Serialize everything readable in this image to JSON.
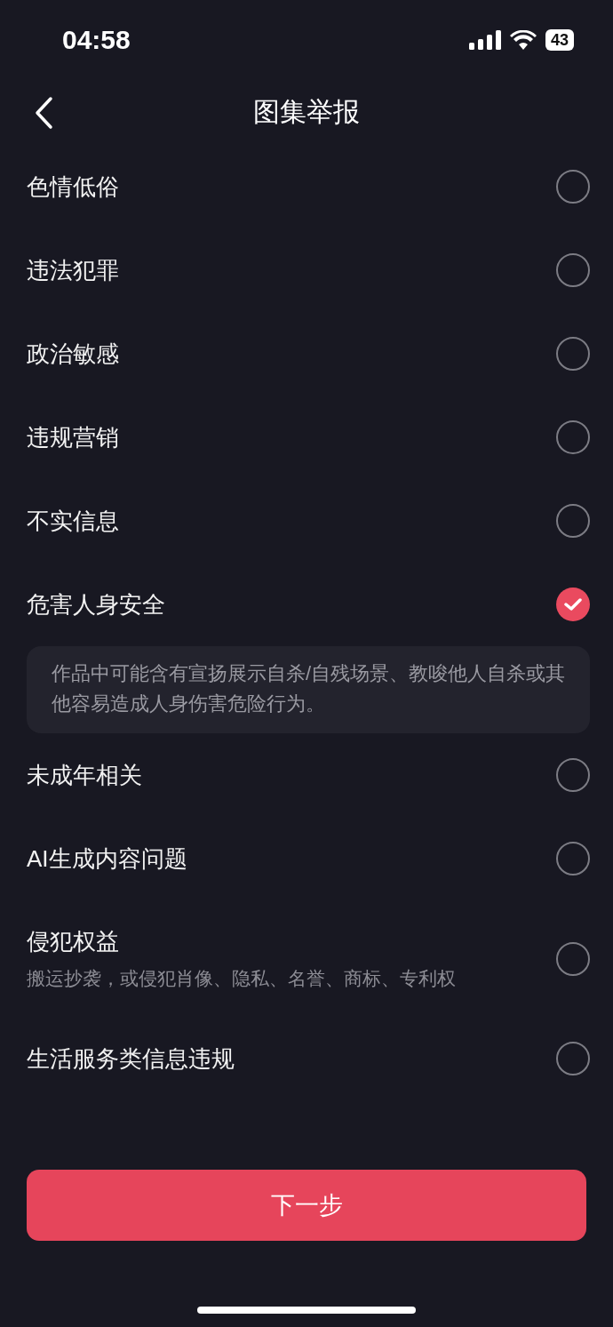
{
  "status_bar": {
    "time": "04:58",
    "battery": "43"
  },
  "header": {
    "title": "图集举报"
  },
  "options": [
    {
      "label": "色情低俗",
      "selected": false
    },
    {
      "label": "违法犯罪",
      "selected": false
    },
    {
      "label": "政治敏感",
      "selected": false
    },
    {
      "label": "违规营销",
      "selected": false
    },
    {
      "label": "不实信息",
      "selected": false
    },
    {
      "label": "危害人身安全",
      "selected": true,
      "description": "作品中可能含有宣扬展示自杀/自残场景、教唆他人自杀或其他容易造成人身伤害危险行为。"
    },
    {
      "label": "未成年相关",
      "selected": false
    },
    {
      "label": "AI生成内容问题",
      "selected": false
    },
    {
      "label": "侵犯权益",
      "selected": false,
      "subtitle": "搬运抄袭，或侵犯肖像、隐私、名誉、商标、专利权"
    },
    {
      "label": "生活服务类信息违规",
      "selected": false
    }
  ],
  "next_button": {
    "label": "下一步"
  }
}
